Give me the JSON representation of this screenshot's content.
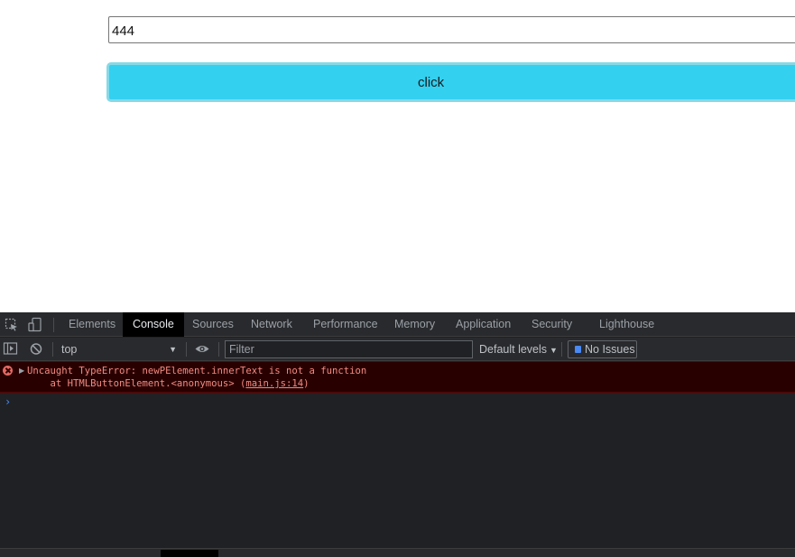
{
  "page": {
    "input_value": "444",
    "button_label": "click"
  },
  "devtools": {
    "tabs": [
      {
        "label": "Elements"
      },
      {
        "label": "Console"
      },
      {
        "label": "Sources"
      },
      {
        "label": "Network"
      },
      {
        "label": "Performance"
      },
      {
        "label": "Memory"
      },
      {
        "label": "Application"
      },
      {
        "label": "Security"
      },
      {
        "label": "Lighthouse"
      }
    ],
    "active_tab": "Console",
    "toolbar": {
      "context": "top",
      "filter_placeholder": "Filter",
      "levels_label": "Default levels",
      "issues_label": "No Issues"
    },
    "console": {
      "error": {
        "line1": "Uncaught TypeError: newPElement.innerText is not a function",
        "line2_prefix": "    at HTMLButtonElement.<anonymous> (",
        "link": "main.js:14",
        "line2_suffix": ")"
      },
      "prompt": "›"
    },
    "icons": {
      "inspect": "inspect-element-icon",
      "device": "device-toolbar-icon",
      "sidebar": "sidebar-toggle-icon",
      "clear": "clear-console-icon",
      "eye": "live-expression-icon",
      "error": "error-icon"
    },
    "colors": {
      "button_bg": "#34d0f0",
      "devtools_bg": "#202124",
      "error_bg": "#290000",
      "error_text": "#f28b82",
      "accent": "#4a8af4"
    }
  }
}
